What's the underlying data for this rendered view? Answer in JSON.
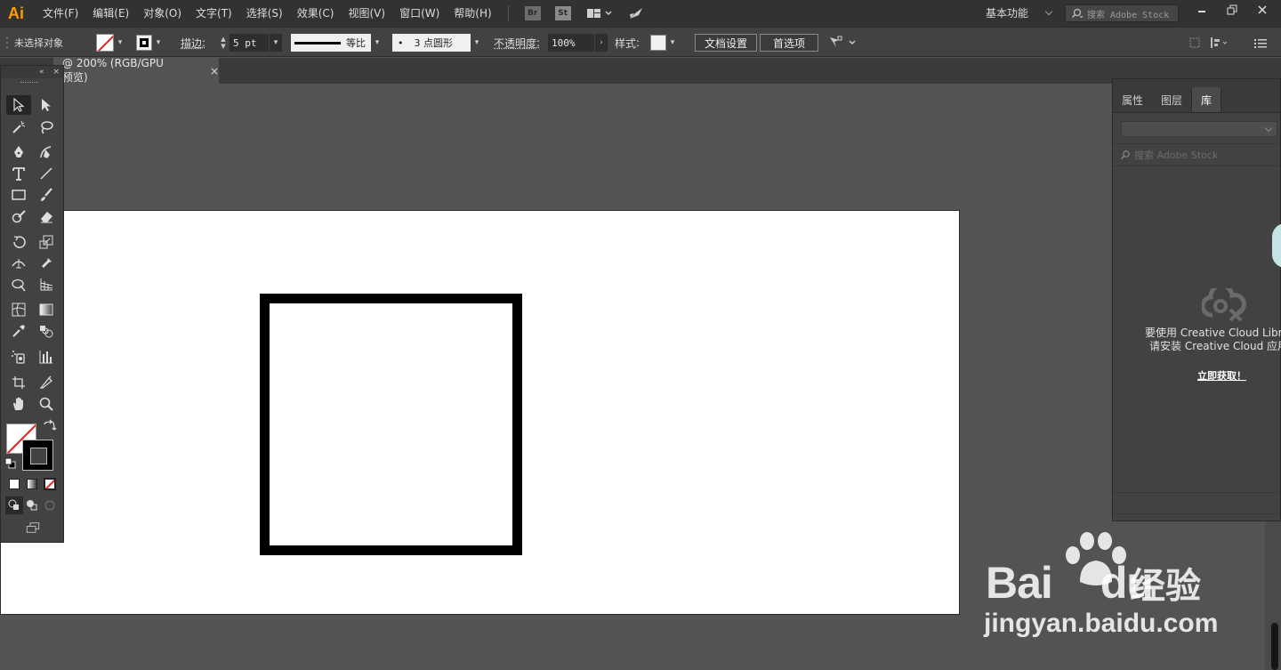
{
  "app": {
    "logo": "Ai"
  },
  "menu": [
    "文件(F)",
    "编辑(E)",
    "对象(O)",
    "文字(T)",
    "选择(S)",
    "效果(C)",
    "视图(V)",
    "窗口(W)",
    "帮助(H)"
  ],
  "menubar_icons": {
    "bridge": "Br",
    "stock": "St"
  },
  "workspace": {
    "label": "基本功能"
  },
  "stock_search": {
    "placeholder": "搜索 Adobe Stock"
  },
  "control": {
    "selection_label": "未选择对象",
    "stroke_label": "描边",
    "stroke_value": "5 pt",
    "profile_label": "等比",
    "brush_label": "3 点圆形",
    "brush_dot": "•",
    "opacity_label": "不透明度",
    "opacity_value": "100%",
    "style_label": "样式",
    "doc_setup": "文档设置",
    "preferences": "首选项"
  },
  "document_tab": {
    "title": "@ 200% (RGB/GPU 预览)",
    "close": "×"
  },
  "toolbar": {
    "collapse": "«",
    "close": "×"
  },
  "library_panel": {
    "tabs": [
      "属性",
      "图层",
      "库"
    ],
    "active_tab": "库",
    "search_placeholder": "搜索 Adobe Stock",
    "message_line1": "要使用 Creative Cloud Librari",
    "message_line2": "请安装 Creative Cloud 应用科",
    "link": "立即获取！"
  },
  "watermark": {
    "brand": "Bai",
    "brand_du": "du",
    "cn": "经验",
    "url": "jingyan.baidu.com"
  },
  "colors": {
    "accent": "#ff9a00",
    "canvas": "#535353",
    "panel": "#424242",
    "menubar": "#323232",
    "no_fill_red": "#e0231b"
  }
}
